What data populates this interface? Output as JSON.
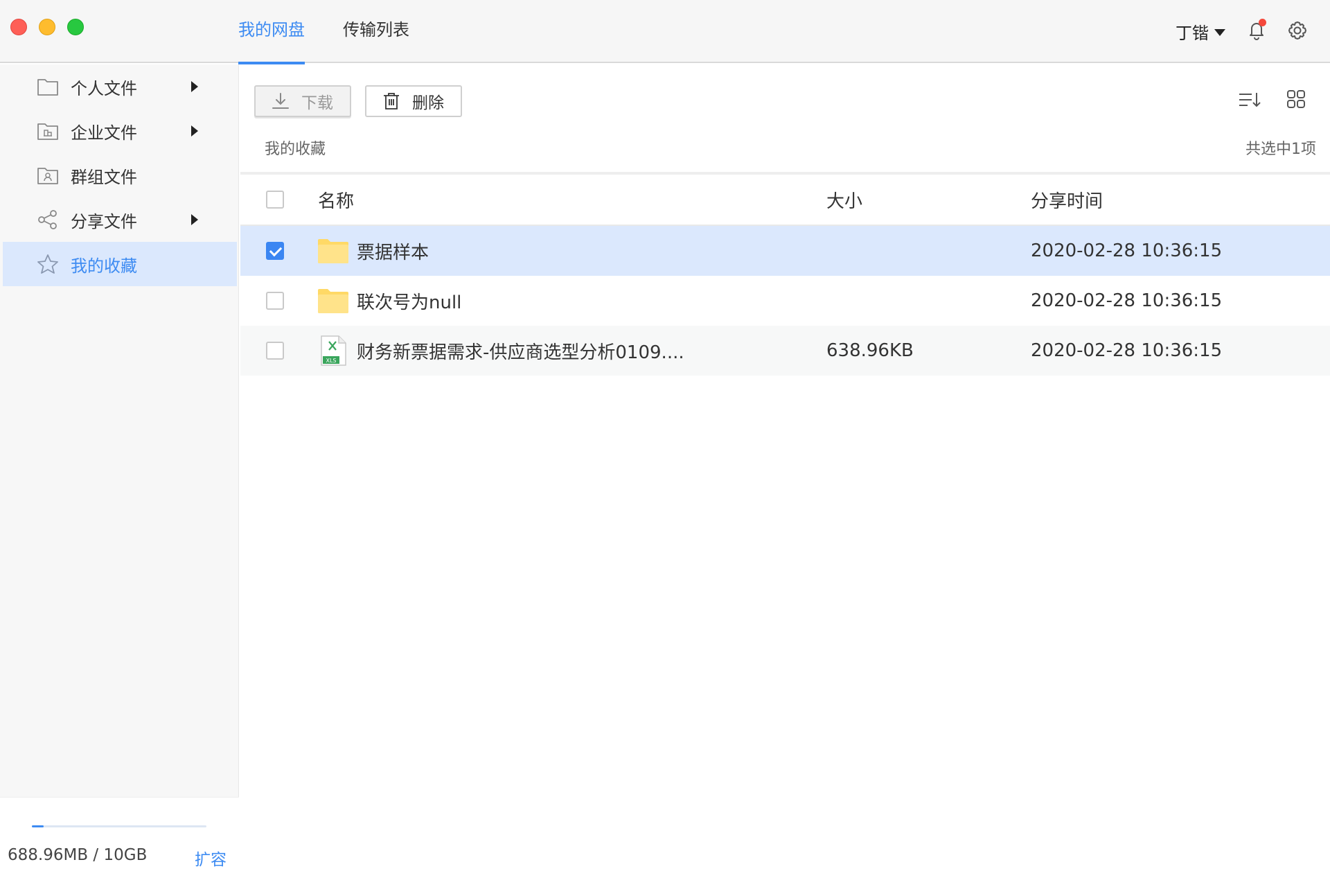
{
  "titlebar": {
    "tabs": [
      {
        "label": "我的网盘",
        "active": true
      },
      {
        "label": "传输列表",
        "active": false
      }
    ],
    "user_name": "丁锴",
    "has_notification": true
  },
  "sidebar": {
    "items": [
      {
        "label": "个人文件",
        "icon": "folder-icon",
        "has_arrow": true
      },
      {
        "label": "企业文件",
        "icon": "enterprise-folder-icon",
        "has_arrow": true
      },
      {
        "label": "群组文件",
        "icon": "group-folder-icon",
        "has_arrow": false
      },
      {
        "label": "分享文件",
        "icon": "share-icon",
        "has_arrow": true
      },
      {
        "label": "我的收藏",
        "icon": "star-icon",
        "has_arrow": false,
        "active": true
      }
    ],
    "storage": {
      "used": "688.96MB",
      "separator": "/",
      "total": "10GB",
      "expand_label": "扩容",
      "used_fraction": 0.067
    }
  },
  "toolbar": {
    "download_label": "下载",
    "delete_label": "删除"
  },
  "breadcrumb": "我的收藏",
  "selection_summary": "共选中1项",
  "table": {
    "headers": {
      "name": "名称",
      "size": "大小",
      "time": "分享时间"
    },
    "rows": [
      {
        "name": "票据样本",
        "type": "folder",
        "size": "",
        "time": "2020-02-28 10:36:15",
        "checked": true
      },
      {
        "name": "联次号为null",
        "type": "folder",
        "size": "",
        "time": "2020-02-28 10:36:15",
        "checked": false
      },
      {
        "name": "财务新票据需求-供应商选型分析0109....",
        "type": "xls",
        "size": "638.96KB",
        "time": "2020-02-28 10:36:15",
        "checked": false
      }
    ]
  },
  "colors": {
    "accent": "#3d8bf2",
    "selected_row": "#dbe8fd",
    "folder": "#ffd966",
    "xls_green": "#3aa55c"
  }
}
